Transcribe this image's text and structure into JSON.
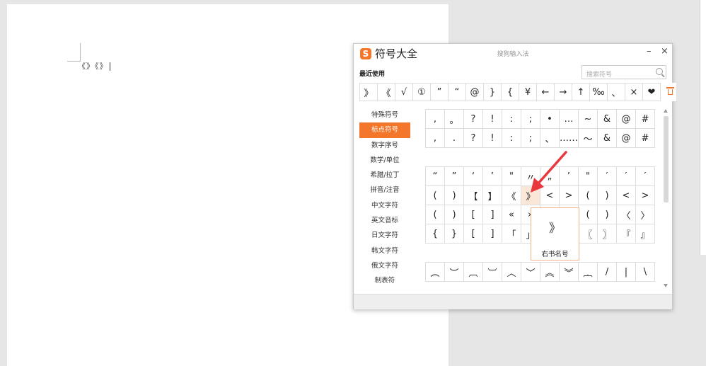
{
  "document": {
    "text": "《》《》"
  },
  "dialog": {
    "logo": "S",
    "title": "符号大全",
    "subtitle": "搜狗输入法",
    "minimize": "–",
    "close": "×",
    "recent_label": "最近使用",
    "search_placeholder": "搜索符号",
    "recent_symbols": [
      "》",
      "《",
      "√",
      "①",
      "”",
      "“",
      "@",
      "}",
      "{",
      "¥",
      "←",
      "→",
      "↑",
      "‰",
      "、",
      "×",
      "❤"
    ],
    "categories": [
      "特殊符号",
      "标点符号",
      "数字序号",
      "数学/单位",
      "希腊/拉丁",
      "拼音/注音",
      "中文字符",
      "英文音标",
      "日文字符",
      "韩文字符",
      "俄文字符",
      "制表符"
    ],
    "active_category": "标点符号",
    "symbol_rows": [
      [
        ",",
        "。",
        "?",
        "!",
        ":",
        ";",
        "•",
        "…",
        "~",
        "&",
        "@",
        "#"
      ],
      [
        ",",
        ".",
        "?",
        "!",
        ":",
        ";",
        "、",
        "……",
        "～",
        "&",
        "@",
        "#"
      ],
      [],
      [
        "“",
        "”",
        "‘",
        "’",
        "\"",
        "〃",
        "„",
        "’",
        "\"",
        "′",
        "′",
        "′"
      ],
      [
        "(",
        ")",
        "【",
        "】",
        "《",
        "》",
        "<",
        ">",
        "(",
        ")",
        "<",
        ">"
      ],
      [
        "(",
        ")",
        "[",
        "]",
        "«",
        "»",
        "(",
        ")",
        "(",
        ")",
        "〈",
        "〉"
      ],
      [
        "{",
        "}",
        "[",
        "]",
        "「",
        "」",
        "『",
        "』",
        "〖",
        "〗",
        "『",
        "』"
      ],
      [],
      [
        "︵",
        "︶",
        "︹",
        "︺",
        "︿",
        "﹀",
        "︽",
        "︾",
        "︷",
        "/",
        "|",
        "\\"
      ]
    ],
    "tooltip": {
      "symbol": "》",
      "name": "右书名号"
    }
  },
  "colors": {
    "accent": "#f4762a",
    "arrow": "#e8383d"
  }
}
